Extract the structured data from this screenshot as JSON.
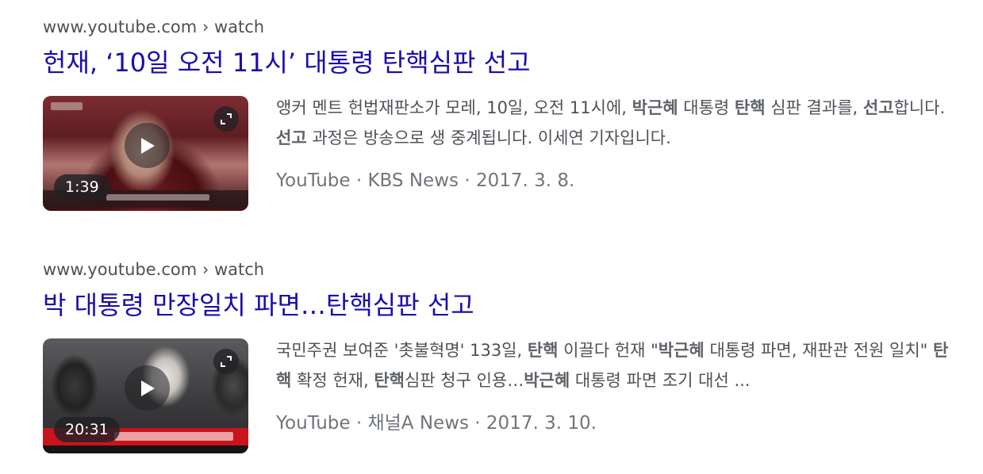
{
  "results": [
    {
      "url": {
        "domain": "www.youtube.com",
        "separator": "›",
        "path": "watch"
      },
      "title": "헌재, ‘10일 오전 11시’ 대통령 탄핵심판 선고",
      "thumbnail": {
        "duration": "1:39",
        "play_icon": "play-icon",
        "expand_icon": "expand-icon"
      },
      "snippet_parts": [
        {
          "text": "앵커 멘트 헌법재판소가 모레, 10일, 오전 11시에, ",
          "bold": false
        },
        {
          "text": "박근혜",
          "bold": true
        },
        {
          "text": " 대통령 ",
          "bold": false
        },
        {
          "text": "탄핵",
          "bold": true
        },
        {
          "text": " 심판 결과를, ",
          "bold": false
        },
        {
          "text": "선고",
          "bold": true
        },
        {
          "text": "합니다. ",
          "bold": false
        },
        {
          "text": "선고",
          "bold": true
        },
        {
          "text": " 과정은 방송으로 생 중계됩니다. 이세연 기자입니다.",
          "bold": false
        }
      ],
      "source": {
        "platform": "YouTube",
        "channel": "KBS News",
        "date": "2017. 3. 8.",
        "dot": "·"
      }
    },
    {
      "url": {
        "domain": "www.youtube.com",
        "separator": "›",
        "path": "watch"
      },
      "title": "박 대통령 만장일치 파면…탄핵심판 선고",
      "thumbnail": {
        "duration": "20:31",
        "play_icon": "play-icon",
        "expand_icon": "expand-icon"
      },
      "snippet_parts": [
        {
          "text": "국민주권 보여준 '촛불혁명' 133일, ",
          "bold": false
        },
        {
          "text": "탄핵",
          "bold": true
        },
        {
          "text": " 이끌다 헌재 \"",
          "bold": false
        },
        {
          "text": "박근혜",
          "bold": true
        },
        {
          "text": " 대통령 파면, 재판관 전원 일치\" ",
          "bold": false
        },
        {
          "text": "탄핵",
          "bold": true
        },
        {
          "text": " 확정 헌재, ",
          "bold": false
        },
        {
          "text": "탄핵",
          "bold": true
        },
        {
          "text": "심판 청구 인용…",
          "bold": false
        },
        {
          "text": "박근혜",
          "bold": true
        },
        {
          "text": " 대통령 파면 조기 대선 ...",
          "bold": false
        }
      ],
      "source": {
        "platform": "YouTube",
        "channel": "채널A News",
        "date": "2017. 3. 10.",
        "dot": "·"
      }
    }
  ]
}
